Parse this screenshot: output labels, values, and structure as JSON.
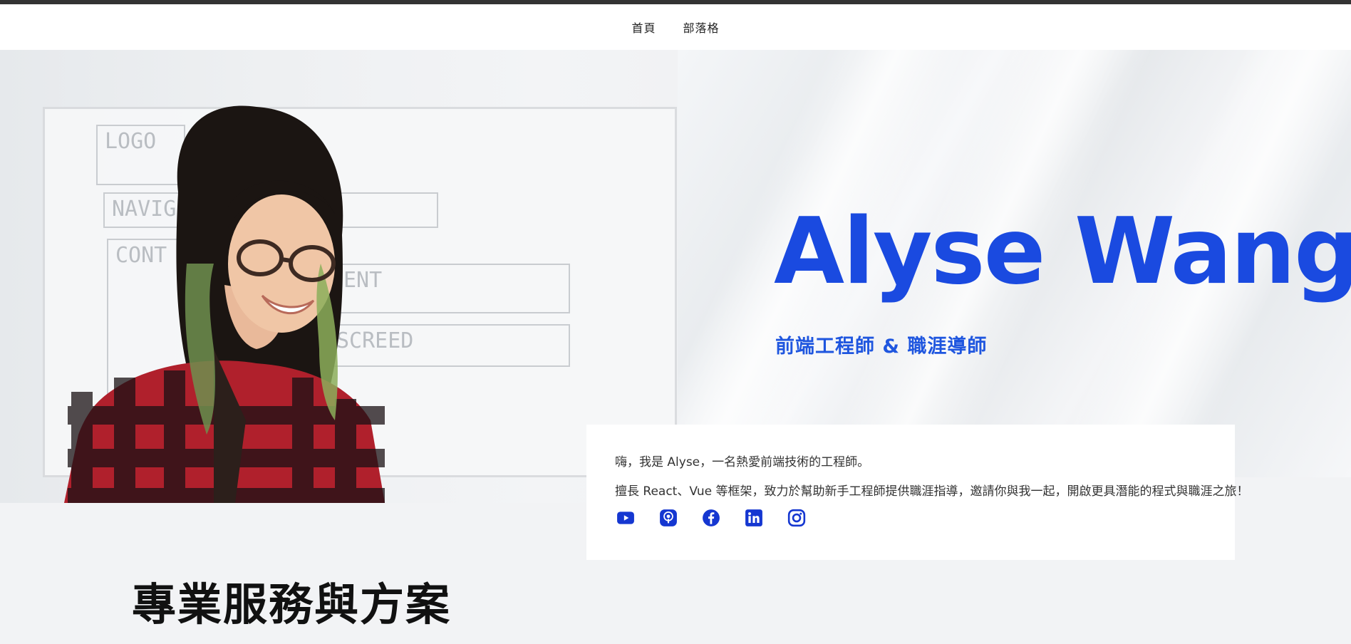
{
  "nav": {
    "items": [
      {
        "label": "首頁"
      },
      {
        "label": "部落格"
      }
    ]
  },
  "hero": {
    "name": "Alyse Wang",
    "subtitle": "前端工程師 & 職涯導師",
    "board_text": [
      "LOGO",
      "NAVIG",
      "CONT",
      "ENT",
      "SCREED"
    ]
  },
  "intro": {
    "line1": "嗨，我是 Alyse，一名熱愛前端技術的工程師。",
    "line2": "擅長 React、Vue 等框架，致力於幫助新手工程師提供職涯指導，邀請你與我一起，開啟更具潛能的程式與職涯之旅！"
  },
  "social": {
    "color": "#1537d1",
    "icons": [
      "youtube-icon",
      "podcast-icon",
      "facebook-icon",
      "linkedin-icon",
      "instagram-icon"
    ]
  },
  "section": {
    "title": "專業服務與方案"
  },
  "colors": {
    "accent": "#1a4ae0",
    "topbar": "#333333",
    "background": "#f2f3f5"
  }
}
